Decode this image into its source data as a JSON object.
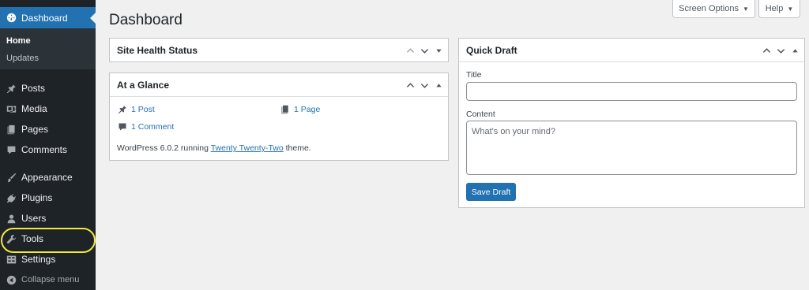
{
  "sidebar": {
    "dashboard": "Dashboard",
    "submenu": {
      "home": "Home",
      "updates": "Updates"
    },
    "items": {
      "posts": "Posts",
      "media": "Media",
      "pages": "Pages",
      "comments": "Comments",
      "appearance": "Appearance",
      "plugins": "Plugins",
      "users": "Users",
      "tools": "Tools",
      "settings": "Settings"
    },
    "collapse": "Collapse menu"
  },
  "header": {
    "title": "Dashboard",
    "screen_options": "Screen Options",
    "help": "Help"
  },
  "site_health": {
    "title": "Site Health Status"
  },
  "at_a_glance": {
    "title": "At a Glance",
    "posts": "1 Post",
    "pages": "1 Page",
    "comments": "1 Comment",
    "version_prefix": "WordPress 6.0.2 running",
    "theme": "Twenty Twenty-Two",
    "version_suffix": "theme."
  },
  "quick_draft": {
    "title": "Quick Draft",
    "title_label": "Title",
    "content_label": "Content",
    "content_placeholder": "What's on your mind?",
    "save_button": "Save Draft"
  },
  "colors": {
    "sidebar_bg": "#1d2327",
    "accent": "#2271b1",
    "highlight": "#f2e93c"
  }
}
